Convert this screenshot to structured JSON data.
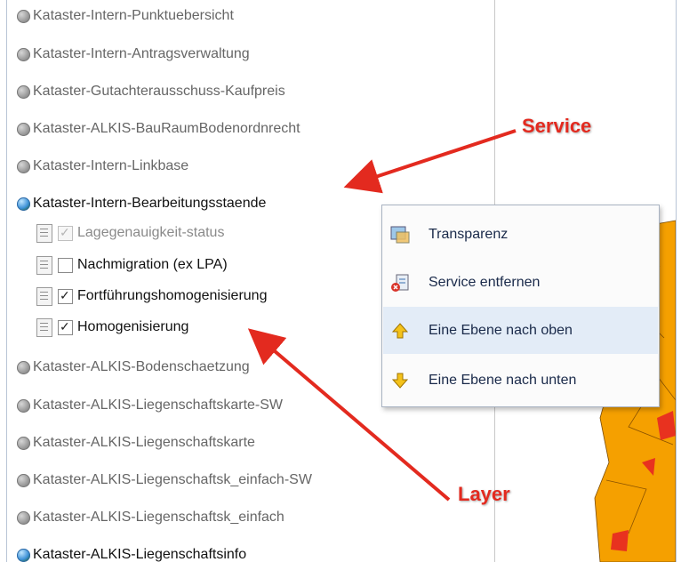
{
  "services": [
    {
      "label": "Kataster-Intern-Punktuebersicht",
      "active": false
    },
    {
      "label": "Kataster-Intern-Antragsverwaltung",
      "active": false
    },
    {
      "label": "Kataster-Gutachterausschuss-Kaufpreis",
      "active": false
    },
    {
      "label": "Kataster-ALKIS-BauRaumBodenordnrecht",
      "active": false
    },
    {
      "label": "Kataster-Intern-Linkbase",
      "active": false
    },
    {
      "label": "Kataster-Intern-Bearbeitungsstaende",
      "active": true
    },
    {
      "label": "Kataster-ALKIS-Bodenschaetzung",
      "active": false
    },
    {
      "label": "Kataster-ALKIS-Liegenschaftskarte-SW",
      "active": false
    },
    {
      "label": "Kataster-ALKIS-Liegenschaftskarte",
      "active": false
    },
    {
      "label": "Kataster-ALKIS-Liegenschaftsk_einfach-SW",
      "active": false
    },
    {
      "label": "Kataster-ALKIS-Liegenschaftsk_einfach",
      "active": false
    },
    {
      "label": "Kataster-ALKIS-Liegenschaftsinfo",
      "active": true
    }
  ],
  "layers": [
    {
      "label": "Lagegenauigkeit-status",
      "checked": true,
      "disabled": true
    },
    {
      "label": "Nachmigration (ex LPA)",
      "checked": false,
      "disabled": false
    },
    {
      "label": "Fortführungshomogenisierung",
      "checked": true,
      "disabled": false
    },
    {
      "label": "Homogenisierung",
      "checked": true,
      "disabled": false
    }
  ],
  "context_menu": {
    "items": [
      {
        "label": "Transparenz",
        "icon": "transparency-icon",
        "highlighted": false
      },
      {
        "label": "Service entfernen",
        "icon": "remove-service-icon",
        "highlighted": false
      },
      {
        "label": "Eine Ebene nach oben",
        "icon": "arrow-up-icon",
        "highlighted": true
      },
      {
        "label": "Eine Ebene nach unten",
        "icon": "arrow-down-icon",
        "highlighted": false
      }
    ]
  },
  "annotations": {
    "service": "Service",
    "layer": "Layer"
  },
  "colors": {
    "annotation": "#e32a1f",
    "highlight": "#e3ecf7",
    "map_fill": "#f5a000",
    "map_accent": "#e8321f"
  }
}
